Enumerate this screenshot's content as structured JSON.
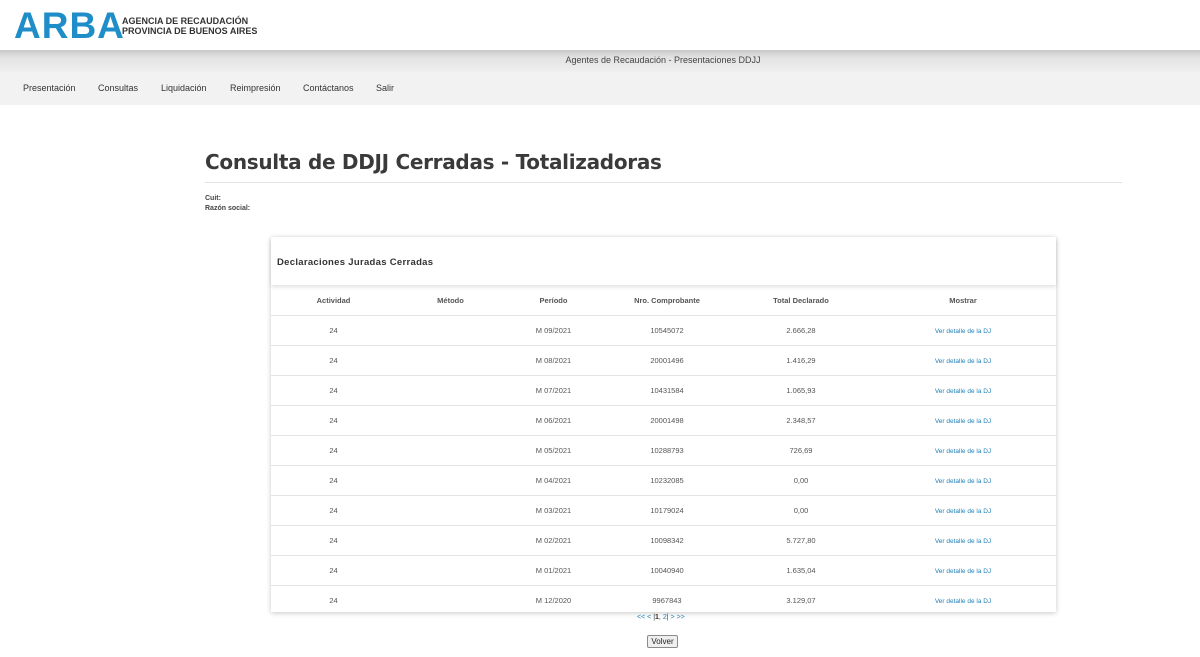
{
  "logo": {
    "word": "ARBA",
    "line1": "AGENCIA DE RECAUDACIÓN",
    "line2": "PROVINCIA DE BUENOS AIRES",
    "color": "#1f8ec8"
  },
  "topbar": {
    "title": "Agentes de Recaudación - Presentaciones DDJJ"
  },
  "nav": {
    "items": [
      "Presentación",
      "Consultas",
      "Liquidación",
      "Reimpresión",
      "Contáctanos",
      "Salir"
    ]
  },
  "page": {
    "title": "Consulta de DDJJ Cerradas - Totalizadoras",
    "cuit_label": "Cuit:",
    "razon_label": "Razón social:"
  },
  "card": {
    "title": "Declaraciones Juradas Cerradas"
  },
  "table": {
    "headers": [
      "Actividad",
      "Método",
      "Período",
      "Nro. Comprobante",
      "Total Declarado",
      "Mostrar"
    ],
    "rows": [
      {
        "actividad": "24",
        "metodo": "",
        "periodo": "M 09/2021",
        "comprobante": "10545072",
        "total": "2.666,28",
        "link": "Ver detalle de la DJ"
      },
      {
        "actividad": "24",
        "metodo": "",
        "periodo": "M 08/2021",
        "comprobante": "20001496",
        "total": "1.416,29",
        "link": "Ver detalle de la DJ"
      },
      {
        "actividad": "24",
        "metodo": "",
        "periodo": "M 07/2021",
        "comprobante": "10431584",
        "total": "1.065,93",
        "link": "Ver detalle de la DJ"
      },
      {
        "actividad": "24",
        "metodo": "",
        "periodo": "M 06/2021",
        "comprobante": "20001498",
        "total": "2.348,57",
        "link": "Ver detalle de la DJ"
      },
      {
        "actividad": "24",
        "metodo": "",
        "periodo": "M 05/2021",
        "comprobante": "10288793",
        "total": "726,69",
        "link": "Ver detalle de la DJ"
      },
      {
        "actividad": "24",
        "metodo": "",
        "periodo": "M 04/2021",
        "comprobante": "10232085",
        "total": "0,00",
        "link": "Ver detalle de la DJ"
      },
      {
        "actividad": "24",
        "metodo": "",
        "periodo": "M 03/2021",
        "comprobante": "10179024",
        "total": "0,00",
        "link": "Ver detalle de la DJ"
      },
      {
        "actividad": "24",
        "metodo": "",
        "periodo": "M 02/2021",
        "comprobante": "10098342",
        "total": "5.727,80",
        "link": "Ver detalle de la DJ"
      },
      {
        "actividad": "24",
        "metodo": "",
        "periodo": "M 01/2021",
        "comprobante": "10040940",
        "total": "1.635,04",
        "link": "Ver detalle de la DJ"
      },
      {
        "actividad": "24",
        "metodo": "",
        "periodo": "M 12/2020",
        "comprobante": "9967843",
        "total": "3.129,07",
        "link": "Ver detalle de la DJ"
      }
    ]
  },
  "pager": {
    "first": "<<",
    "prev": "<",
    "open": "|",
    "current": "1",
    "sep": ",",
    "page2": "2",
    "close": "|",
    "next": ">",
    "last": ">>"
  },
  "buttons": {
    "volver": "Volver"
  }
}
